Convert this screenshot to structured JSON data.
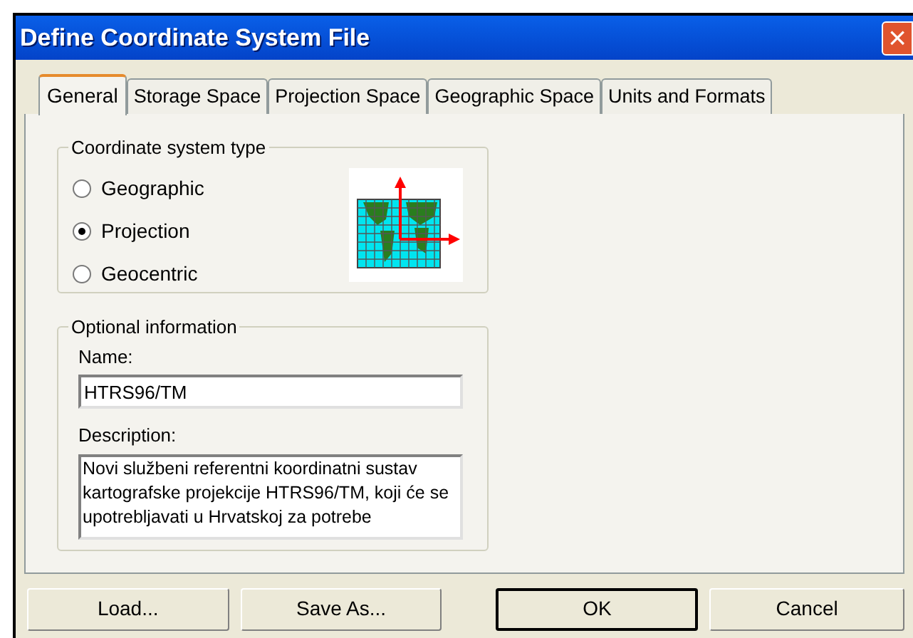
{
  "window": {
    "title": "Define Coordinate System File",
    "close": "×"
  },
  "tabs": [
    {
      "label": "General",
      "selected": true
    },
    {
      "label": "Storage Space",
      "selected": false
    },
    {
      "label": "Projection Space",
      "selected": false
    },
    {
      "label": "Geographic Space",
      "selected": false
    },
    {
      "label": "Units and Formats",
      "selected": false
    }
  ],
  "coordinate_system_type": {
    "title": "Coordinate system type",
    "options": [
      {
        "label": "Geographic",
        "selected": false
      },
      {
        "label": "Projection",
        "selected": true
      },
      {
        "label": "Geocentric",
        "selected": false
      }
    ]
  },
  "optional_information": {
    "title": "Optional information",
    "name_label": "Name:",
    "name_value": "HTRS96/TM",
    "description_label": "Description:",
    "description_value": "Novi službeni referentni koordinatni sustav kartografske projekcije HTRS96/TM, koji će se upotrebljavati u Hrvatskoj za potrebe"
  },
  "buttons": [
    {
      "label": "Load...",
      "default": false
    },
    {
      "label": "Save As...",
      "default": false
    },
    {
      "label": "OK",
      "default": true
    },
    {
      "label": "Cancel",
      "default": false
    }
  ]
}
